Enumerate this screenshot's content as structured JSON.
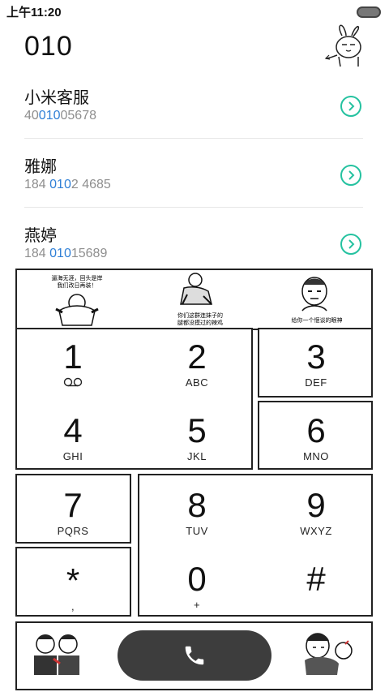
{
  "status_bar": {
    "time": "上午11:20"
  },
  "dialed_number": "010",
  "contacts": [
    {
      "name": "小米客服",
      "num_before": "40",
      "num_match": "010",
      "num_after": "05678"
    },
    {
      "name": "雅娜",
      "num_before": "184 ",
      "num_match": "010",
      "num_after": "2 4685"
    },
    {
      "name": "燕婷",
      "num_before": "184 ",
      "num_match": "010",
      "num_after": "15689"
    }
  ],
  "stickers": {
    "s1": [
      "逼海无涯，回头是岸",
      "我们改日再装！"
    ],
    "s2": [
      "你们这群连妹子的",
      "腿都没摸过的辣鸡"
    ],
    "s3": [
      "给你一个惬谈的眼神"
    ]
  },
  "keys": {
    "k1": {
      "digit": "1",
      "letters": ""
    },
    "k2": {
      "digit": "2",
      "letters": "ABC"
    },
    "k3": {
      "digit": "3",
      "letters": "DEF"
    },
    "k4": {
      "digit": "4",
      "letters": "GHI"
    },
    "k5": {
      "digit": "5",
      "letters": "JKL"
    },
    "k6": {
      "digit": "6",
      "letters": "MNO"
    },
    "k7": {
      "digit": "7",
      "letters": "PQRS"
    },
    "k8": {
      "digit": "8",
      "letters": "TUV"
    },
    "k9": {
      "digit": "9",
      "letters": "WXYZ"
    },
    "kstar": {
      "digit": "*",
      "letters": ","
    },
    "k0": {
      "digit": "0",
      "letters": "+"
    },
    "khash": {
      "digit": "#",
      "letters": ""
    }
  },
  "colors": {
    "accent_blue": "#2f7fd6",
    "arrow_teal": "#25c2a0",
    "call_button": "#3d3d3d"
  },
  "icons": {
    "voicemail": "voicemail-icon",
    "call": "phone-icon",
    "contact_arrow": "chevron-right-icon"
  }
}
